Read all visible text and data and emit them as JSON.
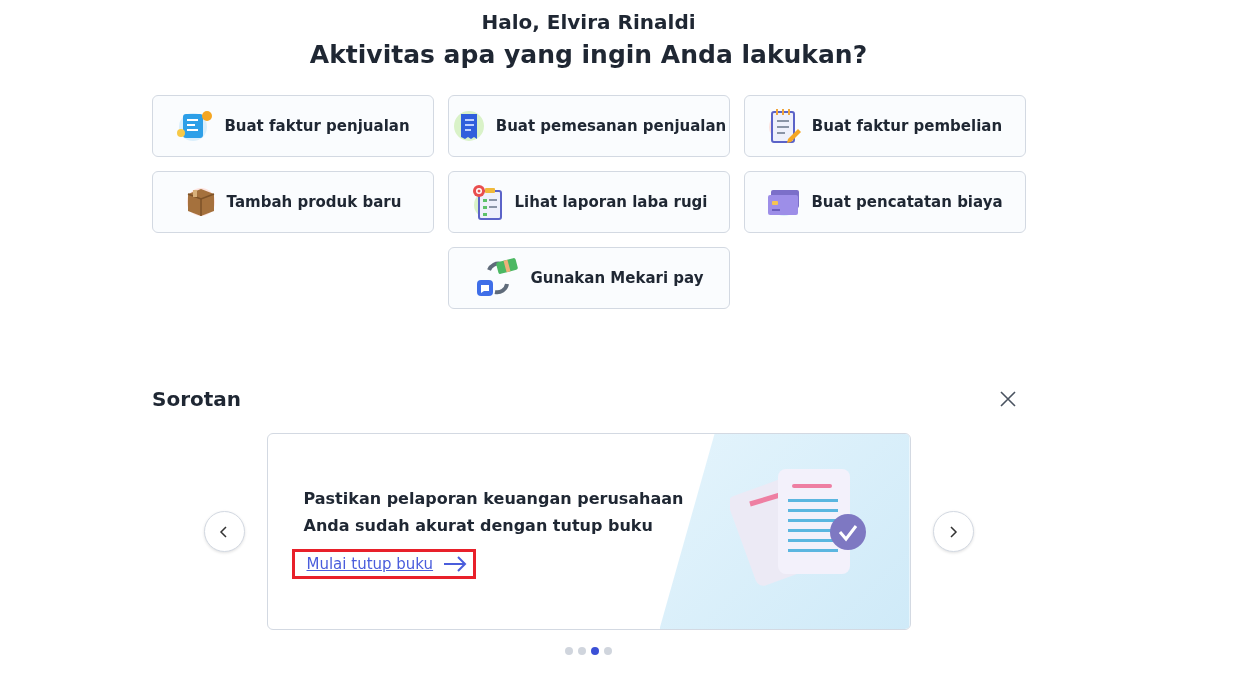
{
  "greeting": "Halo, Elvira Rinaldi",
  "headline": "Aktivitas apa yang ingin Anda lakukan?",
  "actions": [
    {
      "label": "Buat faktur penjualan",
      "kind": "invoice"
    },
    {
      "label": "Buat pemesanan penjualan",
      "kind": "order"
    },
    {
      "label": "Buat faktur pembelian",
      "kind": "purchase"
    },
    {
      "label": "Tambah produk baru",
      "kind": "box"
    },
    {
      "label": "Lihat laporan laba rugi",
      "kind": "report"
    },
    {
      "label": "Buat pencatatan biaya",
      "kind": "card"
    },
    {
      "label": "Gunakan Mekari pay",
      "kind": "exchange"
    }
  ],
  "highlights": {
    "title": "Sorotan",
    "slide": {
      "text": "Pastikan pelaporan keuangan perusahaan Anda sudah akurat dengan tutup buku",
      "link": "Mulai tutup buku",
      "link_highlighted": true
    },
    "dots": [
      {
        "selected": false
      },
      {
        "selected": false
      },
      {
        "selected": true
      },
      {
        "selected": false
      }
    ]
  }
}
